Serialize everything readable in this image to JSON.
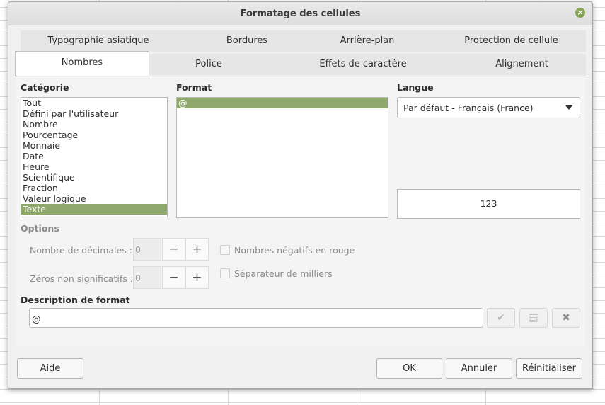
{
  "dialog": {
    "title": "Formatage des cellules"
  },
  "tabs": {
    "row1": [
      "Typographie asiatique",
      "Bordures",
      "Arrière-plan",
      "Protection de cellule"
    ],
    "row2": [
      "Nombres",
      "Police",
      "Effets de caractère",
      "Alignement"
    ],
    "active": "Nombres"
  },
  "category": {
    "label": "Catégorie",
    "items": [
      "Tout",
      "Défini par l'utilisateur",
      "Nombre",
      "Pourcentage",
      "Monnaie",
      "Date",
      "Heure",
      "Scientifique",
      "Fraction",
      "Valeur logique",
      "Texte"
    ],
    "selected": "Texte"
  },
  "format": {
    "label": "Format",
    "items": [
      "@"
    ],
    "selected": "@"
  },
  "language": {
    "label": "Langue",
    "value": "Par défaut - Français (France)"
  },
  "preview": {
    "value": "123"
  },
  "options": {
    "label": "Options",
    "decimals_label": "Nombre de décimales :",
    "decimals_value": "0",
    "leading_zeros_label": "Zéros non significatifs :",
    "leading_zeros_value": "0",
    "minus_symbol": "−",
    "plus_symbol": "+",
    "negative_red_label": "Nombres négatifs en rouge",
    "thousands_sep_label": "Séparateur de milliers"
  },
  "format_code": {
    "label": "Description de format",
    "value": "@"
  },
  "buttons": {
    "help": "Aide",
    "ok": "OK",
    "cancel": "Annuler",
    "reset": "Réinitialiser"
  },
  "colors": {
    "accent": "#8fa86c",
    "close": "#87a556"
  },
  "icons": {
    "close": "close-icon",
    "apply": "checkmark-icon",
    "comment": "comment-icon",
    "delete": "delete-icon"
  }
}
